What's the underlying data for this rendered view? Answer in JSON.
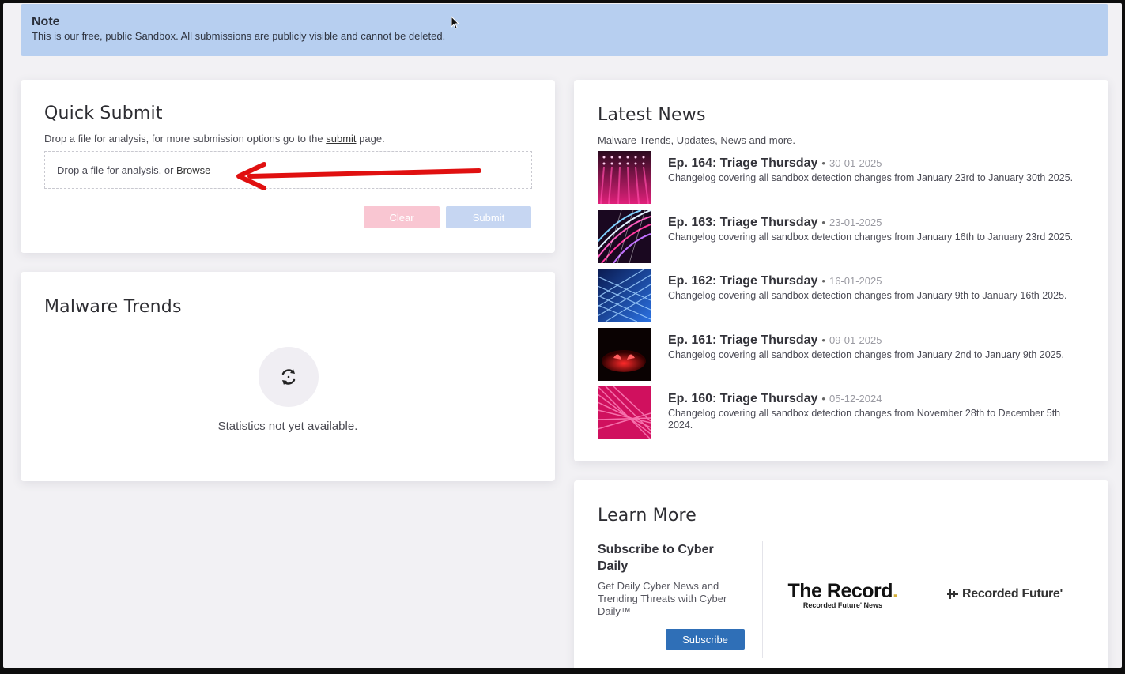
{
  "note": {
    "title": "Note",
    "text": "This is our free, public Sandbox. All submissions are publicly visible and cannot be deleted."
  },
  "quick_submit": {
    "title": "Quick Submit",
    "subtitle_prefix": "Drop a file for analysis, for more submission options go to the ",
    "subtitle_link": "submit",
    "subtitle_suffix": " page.",
    "dropzone_prefix": "Drop a file for analysis, or ",
    "dropzone_link": "Browse",
    "clear_label": "Clear",
    "submit_label": "Submit"
  },
  "malware_trends": {
    "title": "Malware Trends",
    "empty_text": "Statistics not yet available."
  },
  "latest_news": {
    "title": "Latest News",
    "subtitle": "Malware Trends, Updates, News and more.",
    "items": [
      {
        "title": "Ep. 164: Triage Thursday",
        "date": "30-01-2025",
        "desc": "Changelog covering all sandbox detection changes from January 23rd to January 30th 2025."
      },
      {
        "title": "Ep. 163: Triage Thursday",
        "date": "23-01-2025",
        "desc": "Changelog covering all sandbox detection changes from January 16th to January 23rd 2025."
      },
      {
        "title": "Ep. 162: Triage Thursday",
        "date": "16-01-2025",
        "desc": "Changelog covering all sandbox detection changes from January 9th to January 16th 2025."
      },
      {
        "title": "Ep. 161: Triage Thursday",
        "date": "09-01-2025",
        "desc": "Changelog covering all sandbox detection changes from January 2nd to January 9th 2025."
      },
      {
        "title": "Ep. 160: Triage Thursday",
        "date": "05-12-2024",
        "desc": "Changelog covering all sandbox detection changes from November 28th to December 5th 2024."
      }
    ]
  },
  "learn_more": {
    "title": "Learn More",
    "subscribe_title": "Subscribe to Cyber Daily",
    "subscribe_desc": "Get Daily Cyber News and Trending Threats with Cyber Daily™",
    "subscribe_label": "Subscribe",
    "record_logo": "The Record",
    "record_logo_dot": ".",
    "record_sub": "Recorded Future' News",
    "rf_logo": "Recorded Future'"
  },
  "colors": {
    "note_bg": "#b7cff0",
    "subscribe_btn": "#2f6fb7",
    "clear_btn": "#f9c6d2",
    "submit_btn": "#c6d6f2",
    "annotation_arrow": "#e01010"
  }
}
